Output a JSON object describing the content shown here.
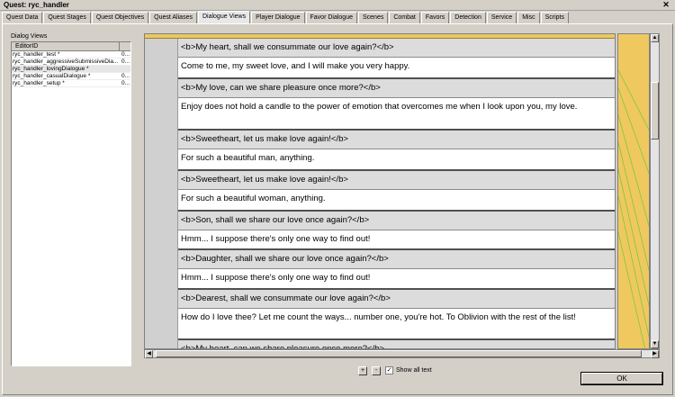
{
  "window": {
    "title": "Quest: ryc_handler",
    "close": "✕"
  },
  "tabs": [
    {
      "label": "Quest Data"
    },
    {
      "label": "Quest Stages"
    },
    {
      "label": "Quest Objectives"
    },
    {
      "label": "Quest Aliases"
    },
    {
      "label": "Dialogue Views",
      "active": true
    },
    {
      "label": "Player Dialogue"
    },
    {
      "label": "Favor Dialogue"
    },
    {
      "label": "Scenes"
    },
    {
      "label": "Combat"
    },
    {
      "label": "Favors"
    },
    {
      "label": "Detection"
    },
    {
      "label": "Service"
    },
    {
      "label": "Misc"
    },
    {
      "label": "Scripts"
    }
  ],
  "dialog_views": {
    "label": "Dialog Views",
    "column_header": "EditorID",
    "items": [
      {
        "name": "ryc_handler_test *",
        "value": "0..."
      },
      {
        "name": "ryc_handler_aggressiveSubmissiveDia...",
        "value": "0..."
      },
      {
        "name": "ryc_handler_lovingDialogue *",
        "value": "",
        "selected": true
      },
      {
        "name": "ryc_handler_casualDialogue *",
        "value": "0..."
      },
      {
        "name": "ryc_handler_setup *",
        "value": "0..."
      }
    ]
  },
  "entries": [
    {
      "prompt": "<b>My heart, shall we consummate our love again?</b>",
      "reply": "Come to me, my sweet love, and I will make you very happy."
    },
    {
      "prompt": "<b>My love, can we share pleasure once more?</b>",
      "reply": "Enjoy does not hold a candle to the power of emotion that overcomes me when I look upon you, my love."
    },
    {
      "prompt": "<b>Sweetheart, let us make love again!</b>",
      "reply": "For such a beautiful man, anything."
    },
    {
      "prompt": "<b>Sweetheart, let us make love again!</b>",
      "reply": "For such a beautiful woman, anything."
    },
    {
      "prompt": "<b>Son, shall we share our love once again?</b>",
      "reply": "Hmm... I suppose there's only one way to find out!"
    },
    {
      "prompt": "<b>Daughter, shall we share our love once again?</b>",
      "reply": "Hmm... I suppose there's only one way to find out!"
    },
    {
      "prompt": "<b>Dearest, shall we consummate our love again?</b>",
      "reply": "How do I love thee? Let me count the ways... number one, you're hot. To Oblivion with the rest of the list!"
    },
    {
      "prompt": "<b>My heart, can we share pleasure once more?</b>",
      "reply": ""
    }
  ],
  "controls": {
    "plus": "+",
    "minus": "-",
    "show_all_label": "Show all text",
    "show_all_checked": "✓",
    "ok": "OK"
  }
}
